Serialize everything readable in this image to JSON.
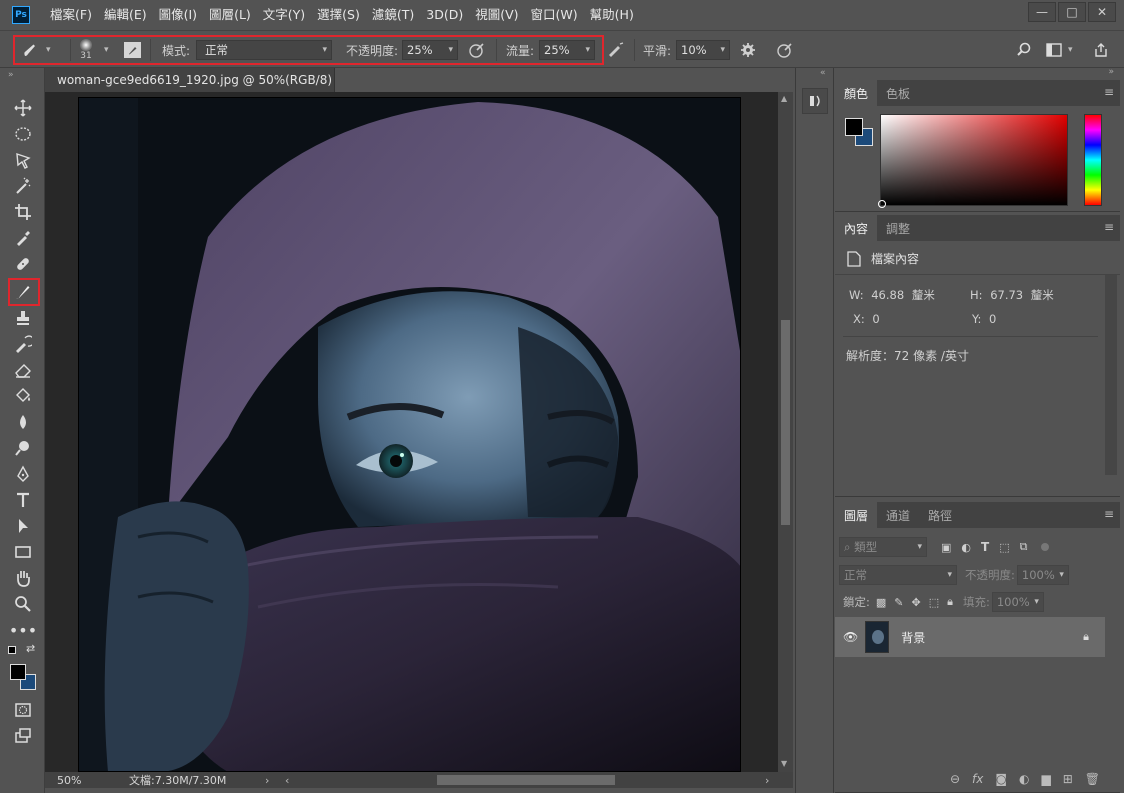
{
  "app": {
    "logo": "Ps",
    "menu": [
      "檔案(F)",
      "編輯(E)",
      "圖像(I)",
      "圖層(L)",
      "文字(Y)",
      "選擇(S)",
      "濾鏡(T)",
      "3D(D)",
      "視圖(V)",
      "窗口(W)",
      "幫助(H)"
    ],
    "window_controls": [
      "—",
      "□",
      "✕"
    ]
  },
  "options": {
    "brush_size": "31",
    "mode_label": "模式:",
    "mode_value": "正常",
    "opacity_label": "不透明度:",
    "opacity_value": "25%",
    "flow_label": "流量:",
    "flow_value": "25%",
    "smoothing_label": "平滑:",
    "smoothing_value": "10%"
  },
  "document": {
    "tab_title": "woman-gce9ed6619_1920.jpg @ 50%(RGB/8) *",
    "close": "×",
    "zoom": "50%",
    "doc_info": "文檔:7.30M/7.30M"
  },
  "panels": {
    "color": {
      "tabs": [
        "顏色",
        "色板"
      ]
    },
    "properties": {
      "tabs": [
        "內容",
        "調整"
      ],
      "header": "檔案內容",
      "w_label": "W:",
      "w_value": "46.88",
      "w_unit": "釐米",
      "h_label": "H:",
      "h_value": "67.73",
      "h_unit": "釐米",
      "x_label": "X:",
      "x_value": "0",
      "y_label": "Y:",
      "y_value": "0",
      "resolution": "解析度：72 像素 /英寸"
    },
    "layers": {
      "tabs": [
        "圖層",
        "通道",
        "路徑"
      ],
      "filter_kind": "類型",
      "blend_mode": "正常",
      "opacity_label": "不透明度:",
      "opacity_value": "100%",
      "lock_label": "鎖定:",
      "fill_label": "填充:",
      "fill_value": "100%",
      "layer_name": "背景"
    }
  },
  "colors": {
    "accent_red": "#e0262d",
    "foreground": "#000000",
    "background": "#1c4a7a"
  }
}
